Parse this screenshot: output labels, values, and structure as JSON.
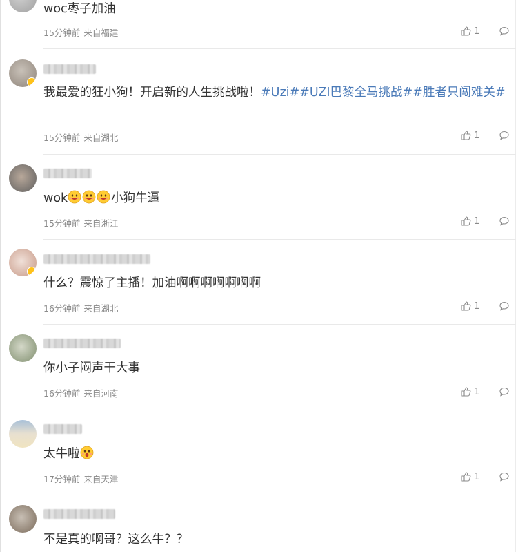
{
  "comments": [
    {
      "text": "woc枣子加油",
      "time": "15分钟前",
      "location": "来自福建",
      "likes": "1",
      "username": "",
      "avatar_colors": [
        "#b0b0b0",
        "#d0d0d0"
      ],
      "has_badge": false
    },
    {
      "text_plain": "我最爱的狂小狗！开启新的人生挑战啦！",
      "hashtags": "#Uzi##UZI巴黎全马挑战##胜者只闯难关#",
      "time": "15分钟前",
      "location": "来自湖北",
      "likes": "1",
      "avatar_colors": [
        "#9a8f86",
        "#c8c1b8"
      ],
      "has_badge": true
    },
    {
      "text_prefix": "wok",
      "emoji_count": 3,
      "text_suffix": "小狗牛逼",
      "time": "15分钟前",
      "location": "来自浙江",
      "likes": "1",
      "avatar_colors": [
        "#6a6a6a",
        "#b8a89a"
      ],
      "has_badge": false
    },
    {
      "text": "什么？震惊了主播！加油啊啊啊啊啊啊啊",
      "time": "16分钟前",
      "location": "来自湖北",
      "likes": "1",
      "avatar_colors": [
        "#d8b8a8",
        "#f0e0d8"
      ],
      "has_badge": true
    },
    {
      "text": "你小子闷声干大事",
      "time": "16分钟前",
      "location": "来自河南",
      "likes": "1",
      "avatar_colors": [
        "#8a9a7a",
        "#d4d8c8"
      ],
      "has_badge": false
    },
    {
      "text_prefix": "太牛啦",
      "emoji_count": 1,
      "text_suffix": "",
      "time": "17分钟前",
      "location": "来自天津",
      "likes": "1",
      "avatar_colors": [
        "#a8c0d8",
        "#f0e4c0"
      ],
      "has_badge": false
    },
    {
      "text": "不是真的啊哥？这么牛？？",
      "avatar_colors": [
        "#8a7a6a",
        "#c8bfb4"
      ],
      "has_badge": false
    }
  ],
  "icons": {
    "like": "thumbs-up-icon",
    "comment": "comment-bubble-icon",
    "emoji": "grinning-emoji-icon"
  }
}
